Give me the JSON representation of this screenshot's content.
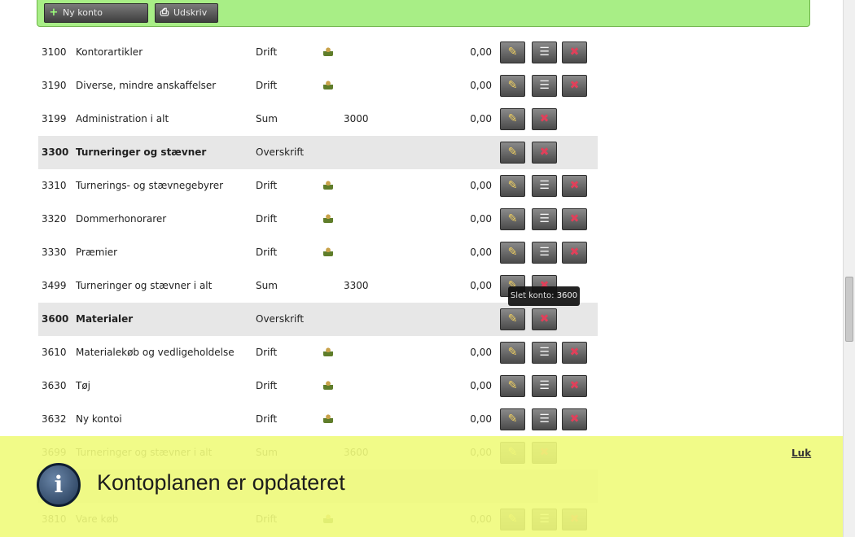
{
  "toolbar": {
    "new_account_label": "Ny konto",
    "print_label": "Udskriv"
  },
  "rows": [
    {
      "no": "3100",
      "name": "Kontorartikler",
      "type": "Drift",
      "ref": "",
      "amount": "0,00",
      "kind": "drift"
    },
    {
      "no": "3190",
      "name": "Diverse, mindre anskaffelser",
      "type": "Drift",
      "ref": "",
      "amount": "0,00",
      "kind": "drift"
    },
    {
      "no": "3199",
      "name": "Administration i alt",
      "type": "Sum",
      "ref": "3000",
      "amount": "0,00",
      "kind": "sum"
    },
    {
      "no": "3300",
      "name": "Turneringer og stævner",
      "type": "Overskrift",
      "ref": "",
      "amount": "",
      "kind": "head"
    },
    {
      "no": "3310",
      "name": "Turnerings- og stævnegebyrer",
      "type": "Drift",
      "ref": "",
      "amount": "0,00",
      "kind": "drift"
    },
    {
      "no": "3320",
      "name": "Dommerhonorarer",
      "type": "Drift",
      "ref": "",
      "amount": "0,00",
      "kind": "drift"
    },
    {
      "no": "3330",
      "name": "Præmier",
      "type": "Drift",
      "ref": "",
      "amount": "0,00",
      "kind": "drift"
    },
    {
      "no": "3499",
      "name": "Turneringer og stævner i alt",
      "type": "Sum",
      "ref": "3300",
      "amount": "0,00",
      "kind": "sum"
    },
    {
      "no": "3600",
      "name": "Materialer",
      "type": "Overskrift",
      "ref": "",
      "amount": "",
      "kind": "head"
    },
    {
      "no": "3610",
      "name": "Materialekøb og vedligeholdelse",
      "type": "Drift",
      "ref": "",
      "amount": "0,00",
      "kind": "drift"
    },
    {
      "no": "3630",
      "name": "Tøj",
      "type": "Drift",
      "ref": "",
      "amount": "0,00",
      "kind": "drift"
    },
    {
      "no": "3632",
      "name": "Ny kontoi",
      "type": "Drift",
      "ref": "",
      "amount": "0,00",
      "kind": "drift"
    },
    {
      "no": "3699",
      "name": "Turneringer og stævner i alt",
      "type": "Sum",
      "ref": "3600",
      "amount": "0,00",
      "kind": "sum"
    },
    {
      "no": "",
      "name": "",
      "type": "",
      "ref": "",
      "amount": "",
      "kind": "head"
    },
    {
      "no": "3810",
      "name": "Vare køb",
      "type": "Drift",
      "ref": "",
      "amount": "0,00",
      "kind": "drift"
    }
  ],
  "tooltip": "Slet konto: 3600",
  "notification": {
    "icon": "info-icon",
    "message": "Kontoplanen er opdateret",
    "close_label": "Luk"
  },
  "icons": {
    "edit": "pencil-icon",
    "list": "list-icon",
    "delete": "delete-icon",
    "person": "person-icon"
  },
  "colors": {
    "toolbar_bg": "#a8ee86",
    "header_row_bg": "#e7e7e7",
    "notification_bg": "#eefa6e"
  }
}
